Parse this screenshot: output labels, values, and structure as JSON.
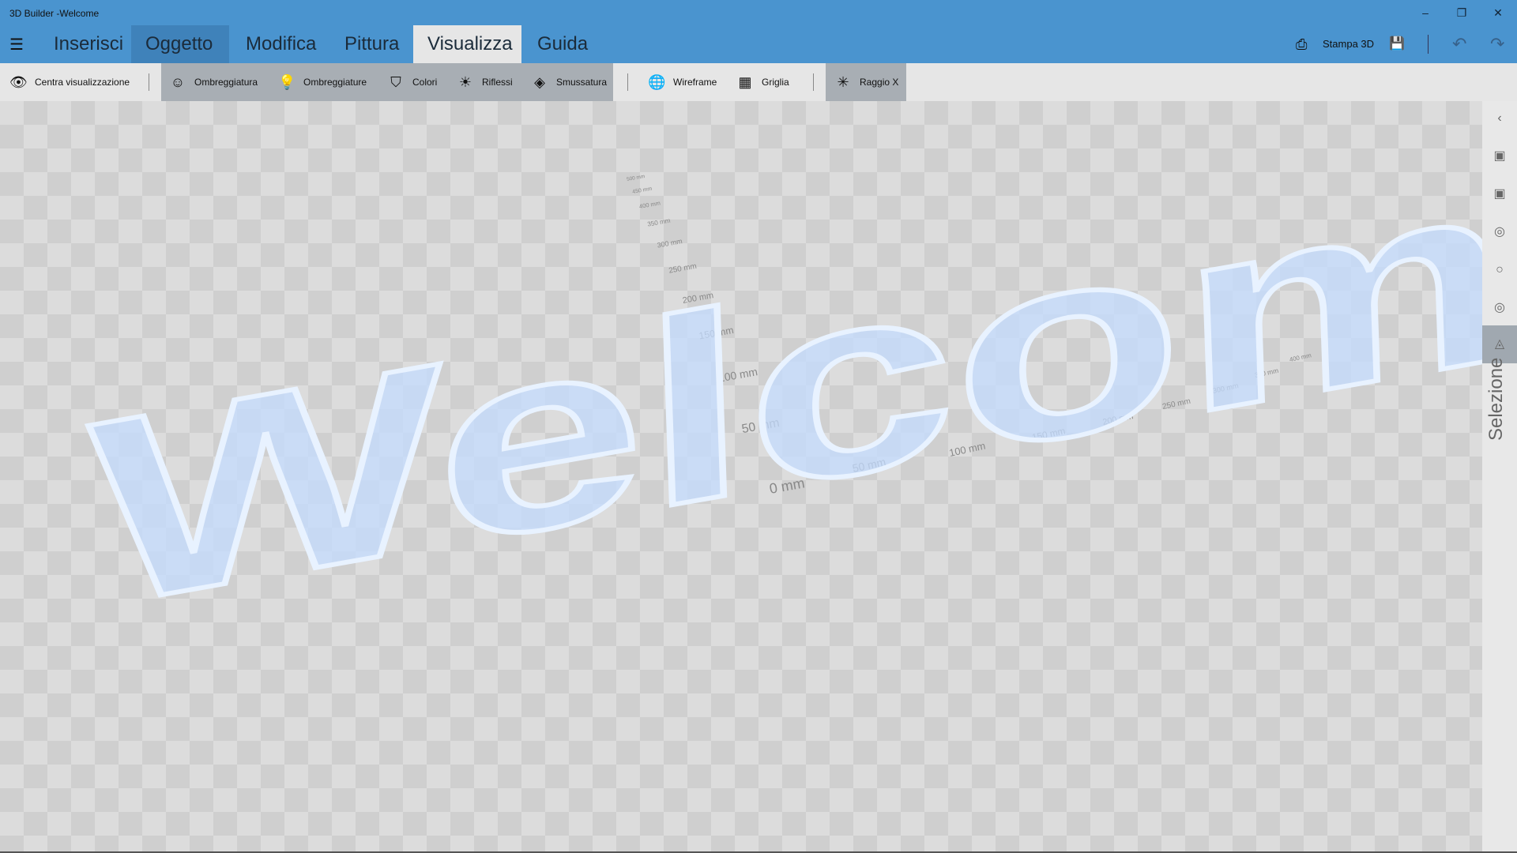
{
  "window": {
    "title": "3D Builder -Welcome",
    "minimize": "–",
    "restore": "❐",
    "close": "✕"
  },
  "tabs": [
    {
      "label": "Inserisci"
    },
    {
      "label": "Oggetto"
    },
    {
      "label": "Modifica"
    },
    {
      "label": "Pittura"
    },
    {
      "label": "Visualizza"
    },
    {
      "label": "Guida"
    }
  ],
  "menu_icon": "☰",
  "right_actions": {
    "print_label": "Stampa 3D",
    "print_icon": "⎙",
    "save_icon": "💾",
    "undo_icon": "↶",
    "redo_icon": "↷"
  },
  "toolbar": [
    {
      "label": "Centra visualizzazione",
      "icon": "👁"
    },
    {
      "label": "Ombreggiatura",
      "icon": "☺"
    },
    {
      "label": "Ombreggiature",
      "icon": "💡"
    },
    {
      "label": "Colori",
      "icon": "⛉"
    },
    {
      "label": "Riflessi",
      "icon": "☀"
    },
    {
      "label": "Smussatura",
      "icon": "◈"
    },
    {
      "label": "Wireframe",
      "icon": "🌐"
    },
    {
      "label": "Griglia",
      "icon": "▦"
    },
    {
      "label": "Raggio X",
      "icon": "✳"
    }
  ],
  "scene": {
    "text": "Welcome",
    "ruler_y": [
      "0 mm",
      "50 mm",
      "100 mm",
      "150 mm",
      "200 mm",
      "250 mm",
      "300 mm",
      "350 mm",
      "400 mm",
      "450 mm",
      "500 mm"
    ],
    "ruler_x": [
      "50 mm",
      "100 mm",
      "150 mm",
      "200 mm",
      "250 mm",
      "300 mm",
      "350 mm",
      "400 mm"
    ]
  },
  "side_panel": {
    "label": "Selezione",
    "icons": [
      "‹",
      "▣",
      "▣",
      "◎",
      "○",
      "◎",
      "◬"
    ]
  }
}
